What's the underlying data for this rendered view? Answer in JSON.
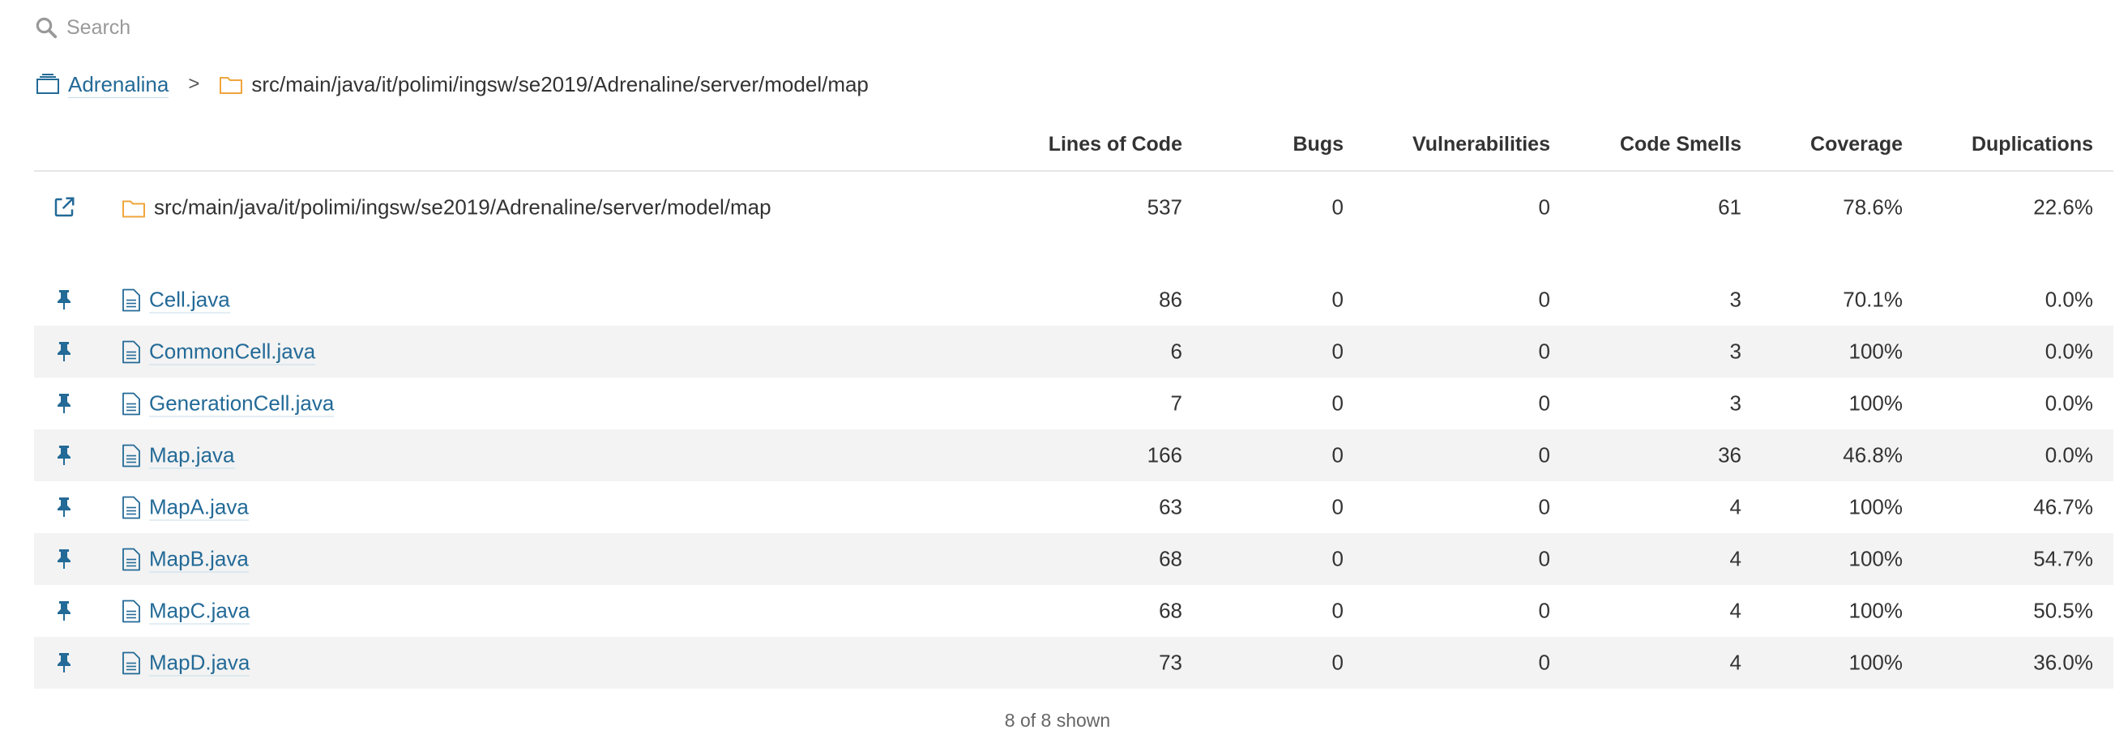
{
  "search": {
    "placeholder": "Search"
  },
  "breadcrumb": {
    "project": "Adrenalina",
    "separator": ">",
    "current_path": "src/main/java/it/polimi/ingsw/se2019/Adrenaline/server/model/map"
  },
  "table": {
    "headers": {
      "lines_of_code": "Lines of Code",
      "bugs": "Bugs",
      "vulnerabilities": "Vulnerabilities",
      "code_smells": "Code Smells",
      "coverage": "Coverage",
      "duplications": "Duplications"
    },
    "base_row": {
      "name": "src/main/java/it/polimi/ingsw/se2019/Adrenaline/server/model/map",
      "lines_of_code": "537",
      "bugs": "0",
      "vulnerabilities": "0",
      "code_smells": "61",
      "coverage": "78.6%",
      "duplications": "22.6%"
    },
    "rows": [
      {
        "name": "Cell.java",
        "lines_of_code": "86",
        "bugs": "0",
        "vulnerabilities": "0",
        "code_smells": "3",
        "coverage": "70.1%",
        "duplications": "0.0%"
      },
      {
        "name": "CommonCell.java",
        "lines_of_code": "6",
        "bugs": "0",
        "vulnerabilities": "0",
        "code_smells": "3",
        "coverage": "100%",
        "duplications": "0.0%"
      },
      {
        "name": "GenerationCell.java",
        "lines_of_code": "7",
        "bugs": "0",
        "vulnerabilities": "0",
        "code_smells": "3",
        "coverage": "100%",
        "duplications": "0.0%"
      },
      {
        "name": "Map.java",
        "lines_of_code": "166",
        "bugs": "0",
        "vulnerabilities": "0",
        "code_smells": "36",
        "coverage": "46.8%",
        "duplications": "0.0%"
      },
      {
        "name": "MapA.java",
        "lines_of_code": "63",
        "bugs": "0",
        "vulnerabilities": "0",
        "code_smells": "4",
        "coverage": "100%",
        "duplications": "46.7%"
      },
      {
        "name": "MapB.java",
        "lines_of_code": "68",
        "bugs": "0",
        "vulnerabilities": "0",
        "code_smells": "4",
        "coverage": "100%",
        "duplications": "54.7%"
      },
      {
        "name": "MapC.java",
        "lines_of_code": "68",
        "bugs": "0",
        "vulnerabilities": "0",
        "code_smells": "4",
        "coverage": "100%",
        "duplications": "50.5%"
      },
      {
        "name": "MapD.java",
        "lines_of_code": "73",
        "bugs": "0",
        "vulnerabilities": "0",
        "code_smells": "4",
        "coverage": "100%",
        "duplications": "36.0%"
      }
    ]
  },
  "footer": {
    "shown_text": "8 of 8 shown"
  },
  "icons": {
    "search": "search-icon",
    "project": "project-icon",
    "folder": "folder-icon",
    "file": "file-icon",
    "pin": "pin-icon",
    "open": "open-in-new-icon"
  },
  "colors": {
    "link": "#236a97",
    "folder": "#f0a53c",
    "row_alt": "#f3f3f3",
    "muted": "#999999"
  }
}
